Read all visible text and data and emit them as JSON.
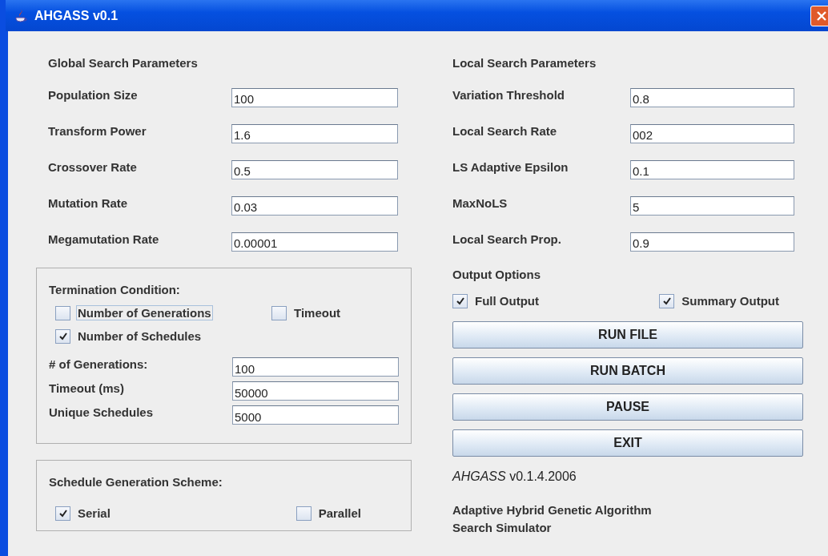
{
  "window": {
    "title": "AHGASS v0.1"
  },
  "global_search": {
    "title": "Global Search Parameters",
    "fields": [
      {
        "label": "Population Size",
        "value": "100"
      },
      {
        "label": "Transform Power",
        "value": "1.6"
      },
      {
        "label": "Crossover Rate",
        "value": "0.5"
      },
      {
        "label": "Mutation Rate",
        "value": "0.03"
      },
      {
        "label": "Megamutation Rate",
        "value": "0.00001"
      }
    ]
  },
  "termination": {
    "title": "Termination Condition:",
    "options": [
      {
        "label": "Number of Generations",
        "checked": false,
        "focused": true
      },
      {
        "label": "Timeout",
        "checked": false,
        "focused": false
      },
      {
        "label": "Number of Schedules",
        "checked": true,
        "focused": false
      }
    ],
    "fields": [
      {
        "label": "# of Generations:",
        "value": "100"
      },
      {
        "label": "Timeout (ms)",
        "value": "50000"
      },
      {
        "label": "Unique Schedules",
        "value": "5000"
      }
    ]
  },
  "schedule_scheme": {
    "title": "Schedule Generation Scheme:",
    "options": [
      {
        "label": "Serial",
        "checked": true
      },
      {
        "label": "Parallel",
        "checked": false
      }
    ]
  },
  "local_search": {
    "title": "Local Search Parameters",
    "fields": [
      {
        "label": "Variation Threshold",
        "value": "0.8"
      },
      {
        "label": "Local Search Rate",
        "value": "002"
      },
      {
        "label": "LS Adaptive Epsilon",
        "value": "0.1"
      },
      {
        "label": "MaxNoLS",
        "value": "5"
      },
      {
        "label": "Local Search Prop.",
        "value": "0.9"
      }
    ]
  },
  "output_options": {
    "title": "Output Options",
    "options": [
      {
        "label": "Full Output",
        "checked": true
      },
      {
        "label": "Summary Output",
        "checked": true
      }
    ]
  },
  "buttons": [
    "RUN FILE",
    "RUN BATCH",
    "PAUSE",
    "EXIT"
  ],
  "version": "*AHGASS* v0.1.4.2006",
  "description": [
    "Adaptive Hybrid Genetic Algorithm",
    "Search Simulator"
  ]
}
